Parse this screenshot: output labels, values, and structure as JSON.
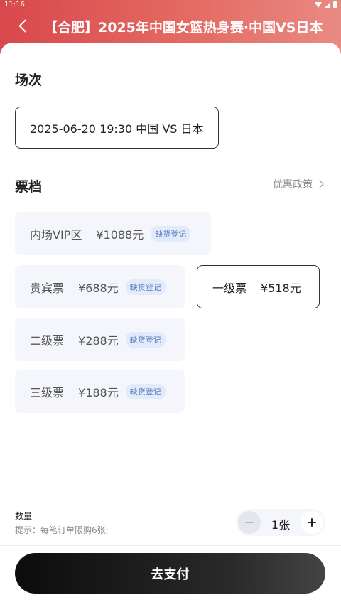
{
  "status_bar": {
    "time": "11:16"
  },
  "header": {
    "title": "【合肥】2025年中国女篮热身赛·中国VS日本"
  },
  "session": {
    "title": "场次",
    "selected": "2025-06-20 19:30 中国 VS 日本"
  },
  "tiers": {
    "title": "票档",
    "policy_link": "优惠政策",
    "items": [
      {
        "name": "内场VIP区",
        "price": "¥1088元",
        "badge": "缺货登记"
      },
      {
        "name": "贵宾票",
        "price": "¥688元",
        "badge": "缺货登记"
      },
      {
        "name": "一级票",
        "price": "¥518元",
        "badge": ""
      },
      {
        "name": "二级票",
        "price": "¥288元",
        "badge": "缺货登记"
      },
      {
        "name": "三级票",
        "price": "¥188元",
        "badge": "缺货登记"
      }
    ]
  },
  "quantity": {
    "label": "数量",
    "hint": "提示：每笔订单限购6张;",
    "value": "1张"
  },
  "pay_button": "去支付",
  "colors": {
    "header_gradient_start": "#d8484c",
    "header_gradient_end": "#e88a84",
    "tier_bg": "#f4f6fb",
    "badge_text": "#5a7fc2",
    "badge_bg": "#e2ebf9",
    "pay_button": "#111111"
  }
}
